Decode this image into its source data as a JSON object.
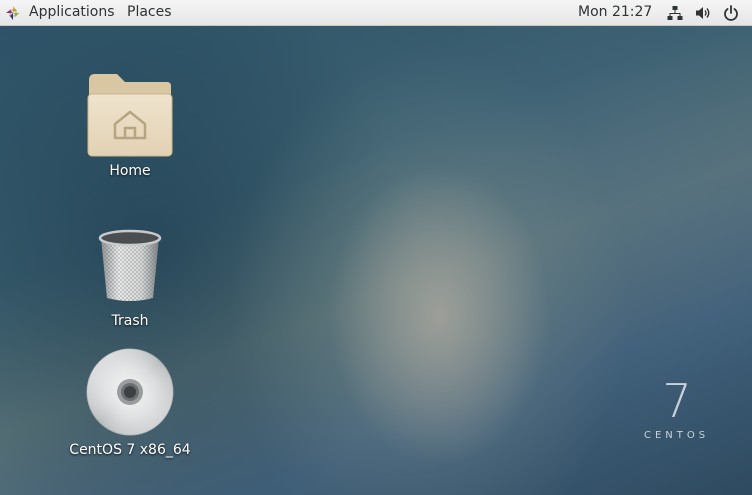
{
  "topbar": {
    "applications_label": "Applications",
    "places_label": "Places",
    "clock": "Mon 21:27",
    "icons": [
      "apps-logo-icon",
      "network-wired-icon",
      "speaker-volume-icon",
      "power-icon"
    ]
  },
  "desktop": {
    "icons": [
      {
        "label": "Home",
        "icon": "home-folder-icon"
      },
      {
        "label": "Trash",
        "icon": "trash-icon"
      },
      {
        "label": "CentOS 7 x86_64",
        "icon": "optical-disc-icon"
      }
    ],
    "brand": {
      "number": "7",
      "name": "CENTOS"
    }
  },
  "colors": {
    "topbar_bg": "#ececec",
    "folder": "#e8d9bf",
    "desktop_blue": "#2f5469"
  }
}
